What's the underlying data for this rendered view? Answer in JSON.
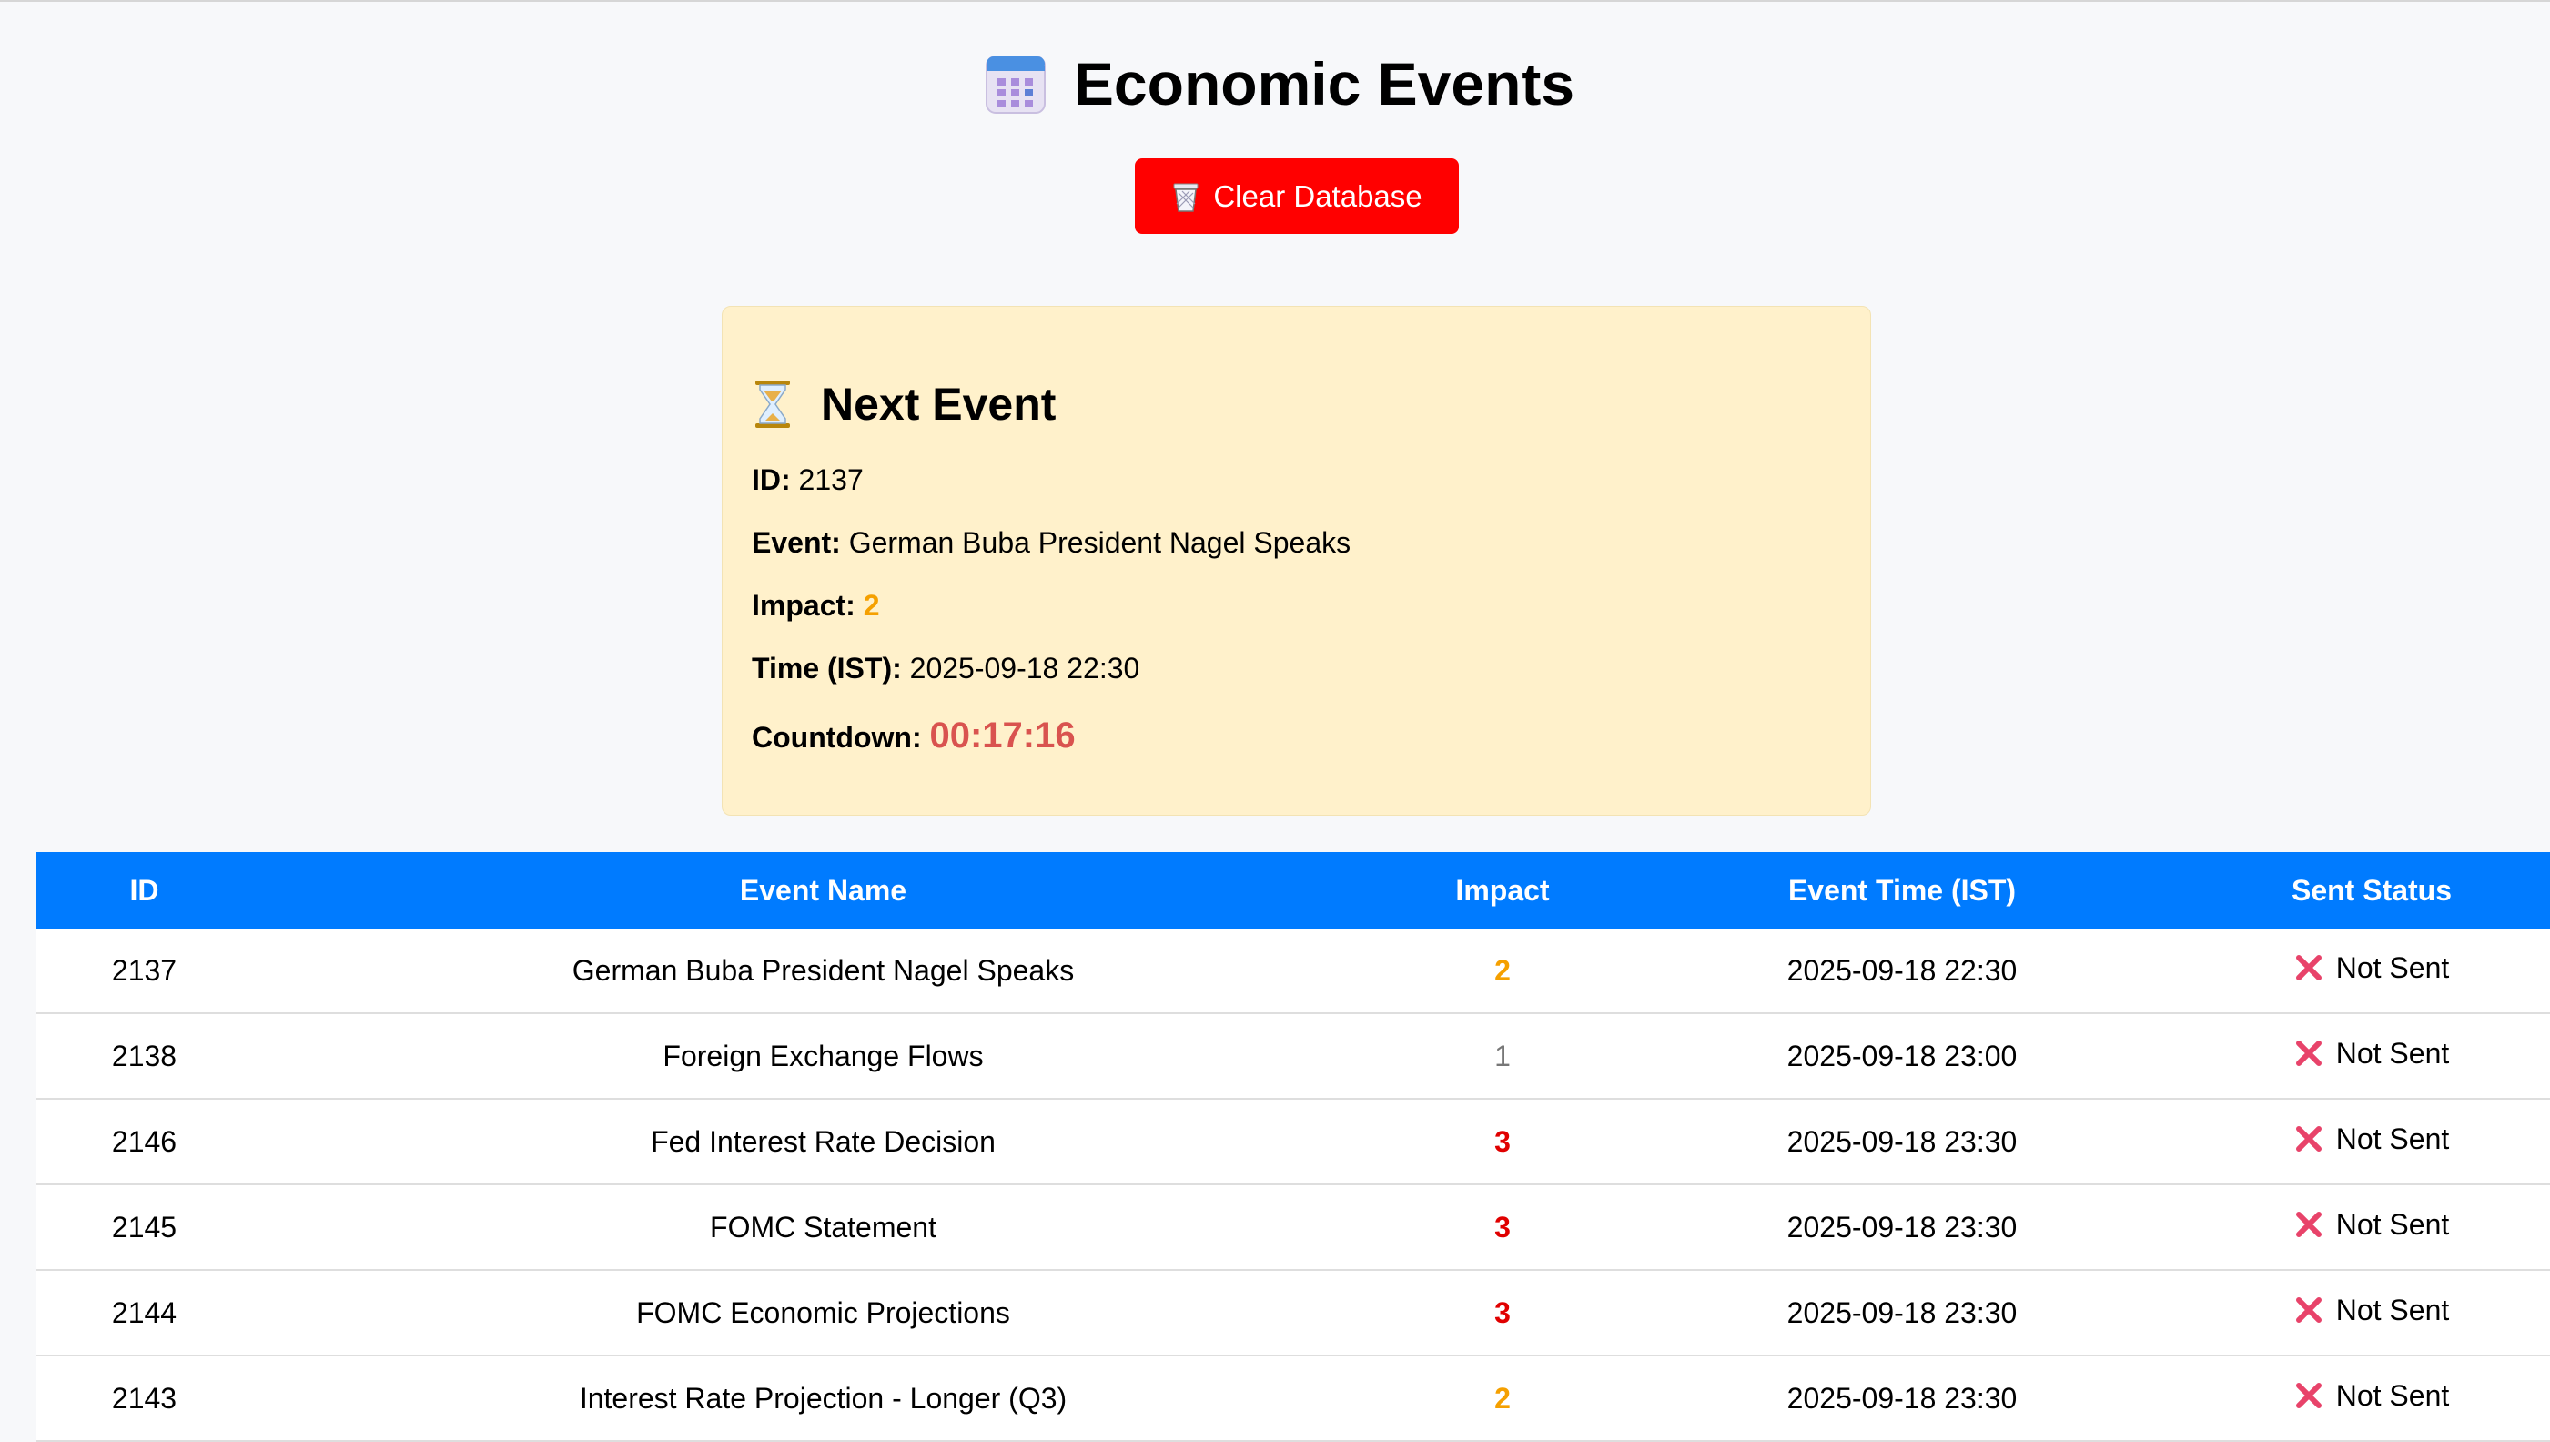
{
  "header": {
    "title": "Economic Events",
    "icon": "calendar-icon"
  },
  "toolbar": {
    "clear_label": "Clear Database",
    "clear_icon": "trash-icon",
    "clear_color": "#ff0000"
  },
  "next_event": {
    "title": "Next Event",
    "icon": "hourglass-icon",
    "id_label": "ID:",
    "id_value": "2137",
    "event_label": "Event:",
    "event_value": "German Buba President Nagel Speaks",
    "impact_label": "Impact:",
    "impact_value": "2",
    "time_label": "Time (IST):",
    "time_value": "2025-09-18 22:30",
    "countdown_label": "Countdown:",
    "countdown_value": "00:17:16"
  },
  "table": {
    "header_color": "#007bff",
    "columns": [
      "ID",
      "Event Name",
      "Impact",
      "Event Time (IST)",
      "Sent Status"
    ],
    "rows": [
      {
        "id": "2137",
        "name": "German Buba President Nagel Speaks",
        "impact": "2",
        "time": "2025-09-18 22:30",
        "status": "Not Sent"
      },
      {
        "id": "2138",
        "name": "Foreign Exchange Flows",
        "impact": "1",
        "time": "2025-09-18 23:00",
        "status": "Not Sent"
      },
      {
        "id": "2146",
        "name": "Fed Interest Rate Decision",
        "impact": "3",
        "time": "2025-09-18 23:30",
        "status": "Not Sent"
      },
      {
        "id": "2145",
        "name": "FOMC Statement",
        "impact": "3",
        "time": "2025-09-18 23:30",
        "status": "Not Sent"
      },
      {
        "id": "2144",
        "name": "FOMC Economic Projections",
        "impact": "3",
        "time": "2025-09-18 23:30",
        "status": "Not Sent"
      },
      {
        "id": "2143",
        "name": "Interest Rate Projection - Longer (Q3)",
        "impact": "2",
        "time": "2025-09-18 23:30",
        "status": "Not Sent"
      }
    ],
    "status_icon": "cross-mark-icon"
  }
}
